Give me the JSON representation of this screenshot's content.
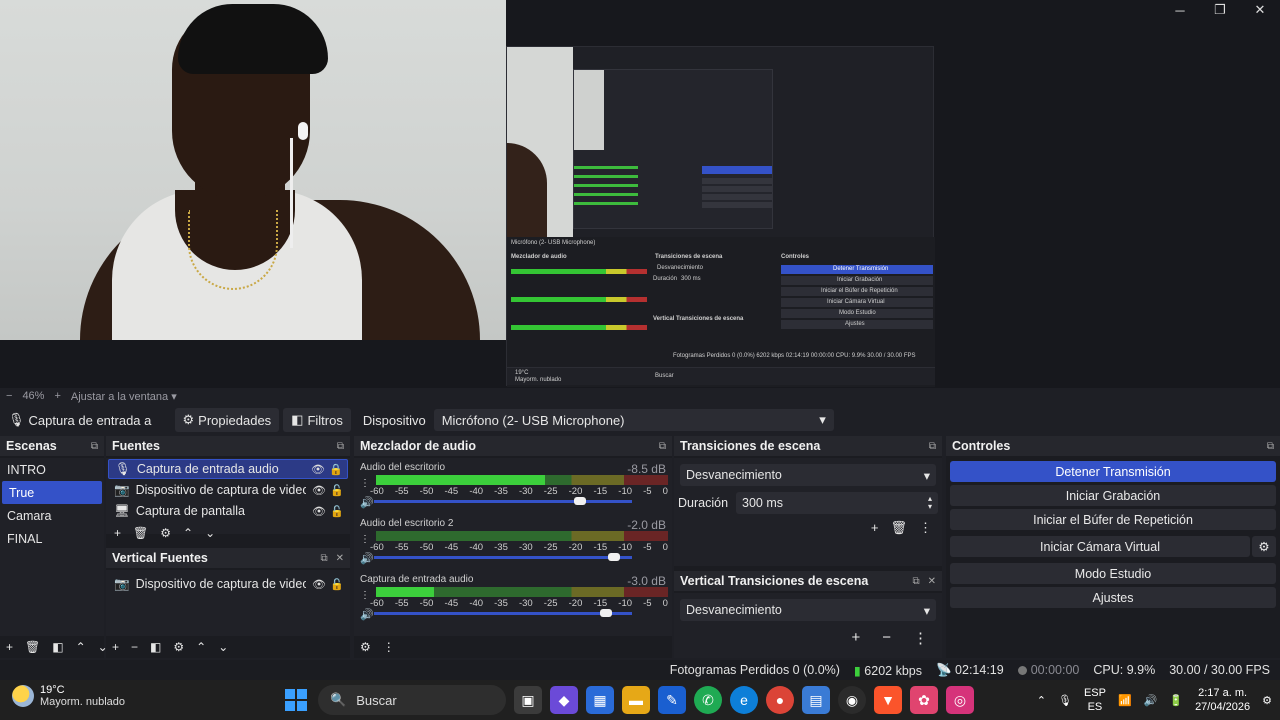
{
  "window": {
    "minimize_icon": "minimize-icon",
    "maximize_icon": "restore-icon",
    "close_icon": "close-icon"
  },
  "preview": {
    "nested": {
      "mic_label": "Micrófono (2- USB Microphone)",
      "mixer_title": "Mezclador de audio",
      "transitions_title": "Transiciones de escena",
      "controls_title": "Controles",
      "transition_value": "Desvanecimiento",
      "duration_label": "Duración",
      "duration_value": "300 ms",
      "vertical_title": "Vertical Transiciones de escena",
      "controls": [
        "Detener Transmisión",
        "Iniciar Grabación",
        "Iniciar el Búfer de Repetición",
        "Iniciar Cámara Virtual",
        "Modo Estudio",
        "Ajustes"
      ],
      "status": "Fotogramas Perdidos 0 (0.0%)   6202 kbps   02:14:19   00:00:00   CPU: 9.9%   30.00 / 30.00 FPS",
      "search": "Buscar",
      "weather": "19°C",
      "weather_desc": "Mayorm. nublado"
    }
  },
  "zoom_bar": {
    "zoom_out": "−",
    "zoom_value": "46%",
    "zoom_in": "+",
    "fit_label": "Ajustar a la ventana"
  },
  "source_bar": {
    "source_name": "Captura de entrada a",
    "properties_label": "Propiedades",
    "filters_label": "Filtros",
    "device_label": "Dispositivo",
    "device_value": "Micrófono (2- USB Microphone)"
  },
  "scenes": {
    "title": "Escenas",
    "items": [
      "INTRO",
      "True",
      "Camara",
      "FINAL"
    ],
    "active_index": 1
  },
  "sources": {
    "title": "Fuentes",
    "items": [
      {
        "label": "Captura de entrada audio",
        "icon": "microphone-icon"
      },
      {
        "label": "Dispositivo de captura de video",
        "icon": "camera-icon"
      },
      {
        "label": "Captura de pantalla",
        "icon": "monitor-icon"
      }
    ],
    "vertical_title": "Vertical Fuentes",
    "vertical_items": [
      {
        "label": "Dispositivo de captura de video",
        "icon": "camera-icon"
      }
    ]
  },
  "mixer": {
    "title": "Mezclador de audio",
    "scale": [
      "-60",
      "-55",
      "-50",
      "-45",
      "-40",
      "-35",
      "-30",
      "-25",
      "-20",
      "-15",
      "-10",
      "-5",
      "0"
    ],
    "channels": [
      {
        "name": "Audio del escritorio",
        "db": "-8.5 dB",
        "level": 0.58,
        "volume": 0.8
      },
      {
        "name": "Audio del escritorio 2",
        "db": "-2.0 dB",
        "level": 0.0,
        "volume": 0.93
      },
      {
        "name": "Captura de entrada audio",
        "db": "-3.0 dB",
        "level": 0.2,
        "volume": 0.9
      }
    ]
  },
  "transitions": {
    "title": "Transiciones de escena",
    "value": "Desvanecimiento",
    "duration_label": "Duración",
    "duration_value": "300 ms",
    "vertical_title": "Vertical Transiciones de escena",
    "vertical_value": "Desvanecimiento"
  },
  "controls": {
    "title": "Controles",
    "buttons": [
      "Detener Transmisión",
      "Iniciar Grabación",
      "Iniciar el Búfer de Repetición",
      "Iniciar Cámara Virtual",
      "Modo Estudio",
      "Ajustes"
    ]
  },
  "status": {
    "dropped": "Fotogramas Perdidos 0 (0.0%)",
    "bitrate": "6202 kbps",
    "stream_time": "02:14:19",
    "rec_time": "00:00:00",
    "cpu": "CPU: 9.9%",
    "fps": "30.00 / 30.00 FPS"
  },
  "taskbar": {
    "weather_temp": "19°C",
    "weather_desc": "Mayorm. nublado",
    "search_placeholder": "Buscar",
    "lang_top": "ESP",
    "lang_bottom": "ES",
    "time": "2:17 a. m.",
    "date": "27/04/2026"
  },
  "colors": {
    "accent": "#3452c8",
    "meter_green": "#3ccf3c",
    "meter_yellow": "#c8c82c",
    "meter_red": "#b53030"
  }
}
